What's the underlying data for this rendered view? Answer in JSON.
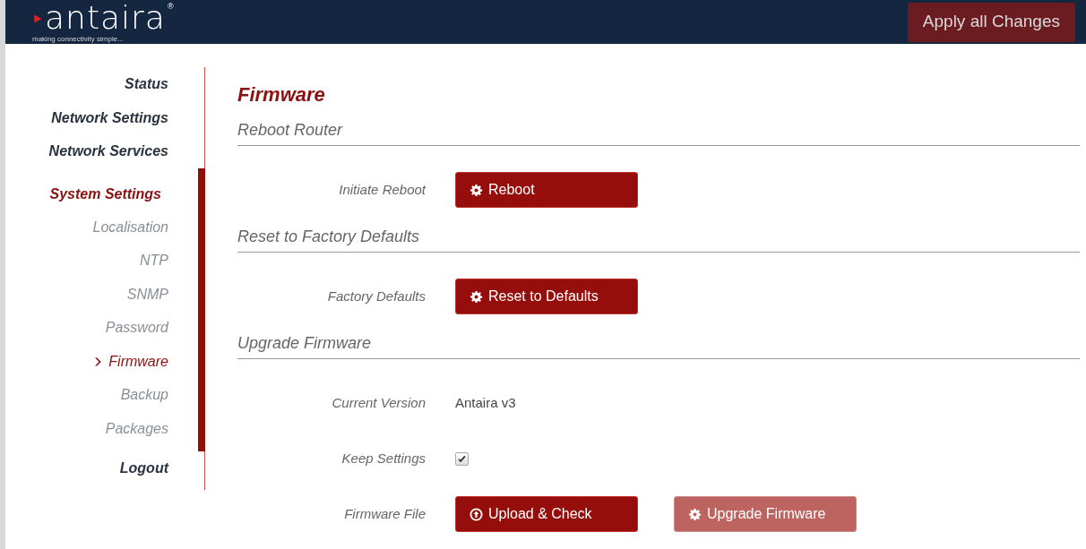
{
  "header": {
    "logo": "antaira",
    "registered": "®",
    "tagline": "making connectivity simple...",
    "apply_button": "Apply all Changes"
  },
  "sidebar": {
    "items": [
      {
        "label": "Status",
        "selected": false
      },
      {
        "label": "Network Settings",
        "selected": false
      },
      {
        "label": "Network Services",
        "selected": false
      },
      {
        "label": "System Settings",
        "selected": true,
        "expanded": true,
        "children": [
          {
            "label": "Localisation",
            "selected": false
          },
          {
            "label": "NTP",
            "selected": false
          },
          {
            "label": "SNMP",
            "selected": false
          },
          {
            "label": "Password",
            "selected": false
          },
          {
            "label": "Firmware",
            "selected": true
          },
          {
            "label": "Backup",
            "selected": false
          },
          {
            "label": "Packages",
            "selected": false
          }
        ]
      },
      {
        "label": "Logout",
        "selected": false
      }
    ]
  },
  "page_title": "Firmware",
  "sections": [
    {
      "heading": "Reboot Router",
      "rows": [
        {
          "kind": "buttons",
          "label": "Initiate Reboot",
          "buttons": [
            {
              "kind": "settings",
              "label": "Reboot",
              "disabled": false
            }
          ]
        }
      ]
    },
    {
      "heading": "Reset to Factory Defaults",
      "rows": [
        {
          "kind": "buttons",
          "label": "Factory Defaults",
          "buttons": [
            {
              "kind": "settings",
              "label": "Reset to Defaults",
              "disabled": false
            }
          ]
        }
      ]
    },
    {
      "heading": "Upgrade Firmware",
      "rows": [
        {
          "kind": "text",
          "label": "Current Version",
          "value": "Antaira v3"
        },
        {
          "kind": "checkbox",
          "label": "Keep Settings",
          "checked": true
        },
        {
          "kind": "buttons",
          "label": "Firmware File",
          "buttons": [
            {
              "kind": "upload",
              "label": "Upload & Check",
              "disabled": false
            },
            {
              "kind": "settings",
              "label": "Upgrade Firmware",
              "disabled": true
            }
          ]
        }
      ]
    }
  ]
}
